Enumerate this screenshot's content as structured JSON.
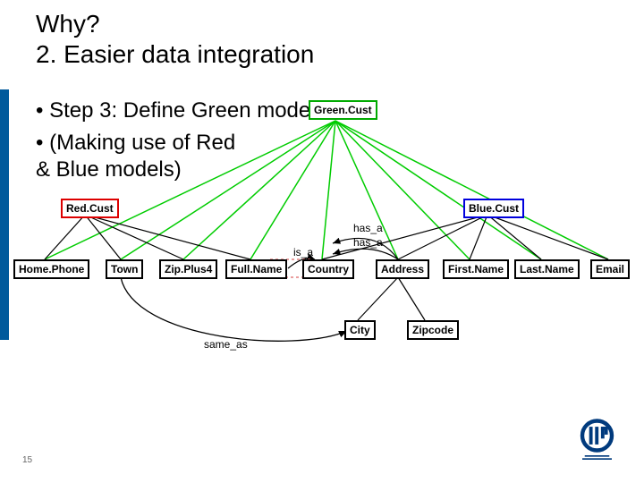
{
  "title": {
    "line1": "Why?",
    "line2": "2. Easier data integration"
  },
  "bullets": {
    "b1": "Step 3: Define Green model",
    "b2": "(Making use of Red\n& Blue models)"
  },
  "nodes": {
    "green": "Green.Cust",
    "red": "Red.Cust",
    "blue": "Blue.Cust",
    "homephone": "Home.Phone",
    "town": "Town",
    "zipplus4": "Zip.Plus4",
    "fullname": "Full.Name",
    "country": "Country",
    "address": "Address",
    "firstname": "First.Name",
    "lastname": "Last.Name",
    "email": "Email",
    "city": "City",
    "zipcode": "Zipcode"
  },
  "edgeLabels": {
    "hasa1": "has_a",
    "hasa2": "has_a",
    "isa": "is_a",
    "sameas": "same_as"
  },
  "pageNumber": "15"
}
